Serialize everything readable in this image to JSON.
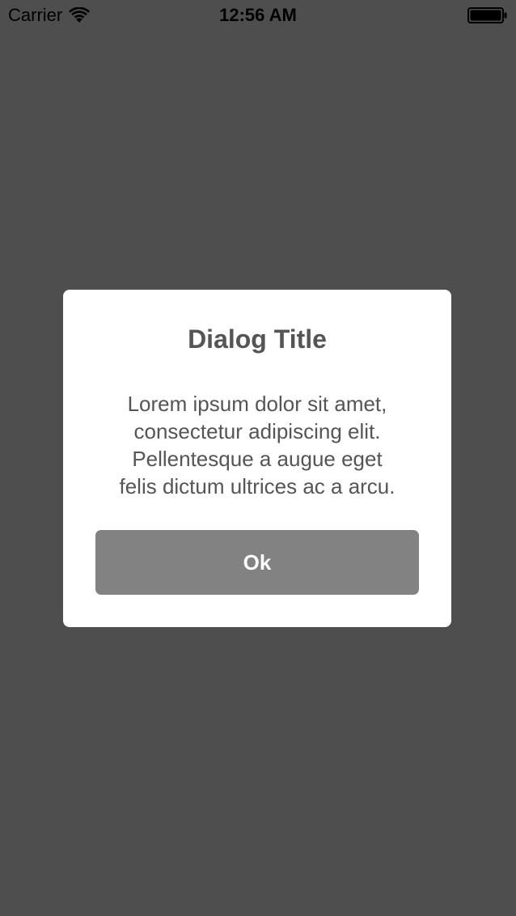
{
  "status_bar": {
    "carrier": "Carrier",
    "time": "12:56 AM",
    "wifi_icon": "wifi-icon",
    "battery_icon": "battery-full-icon"
  },
  "dialog": {
    "title": "Dialog Title",
    "message_lines": [
      "Lorem ipsum dolor sit amet,",
      "consectetur adipiscing elit.",
      "Pellentesque a augue eget",
      "felis dictum ultrices ac a arcu."
    ],
    "ok_label": "Ok"
  },
  "colors": {
    "overlay": "#4e4e4e",
    "dialog_background": "#ffffff",
    "text": "#555555",
    "button": "#828282",
    "button_text": "#ffffff"
  }
}
